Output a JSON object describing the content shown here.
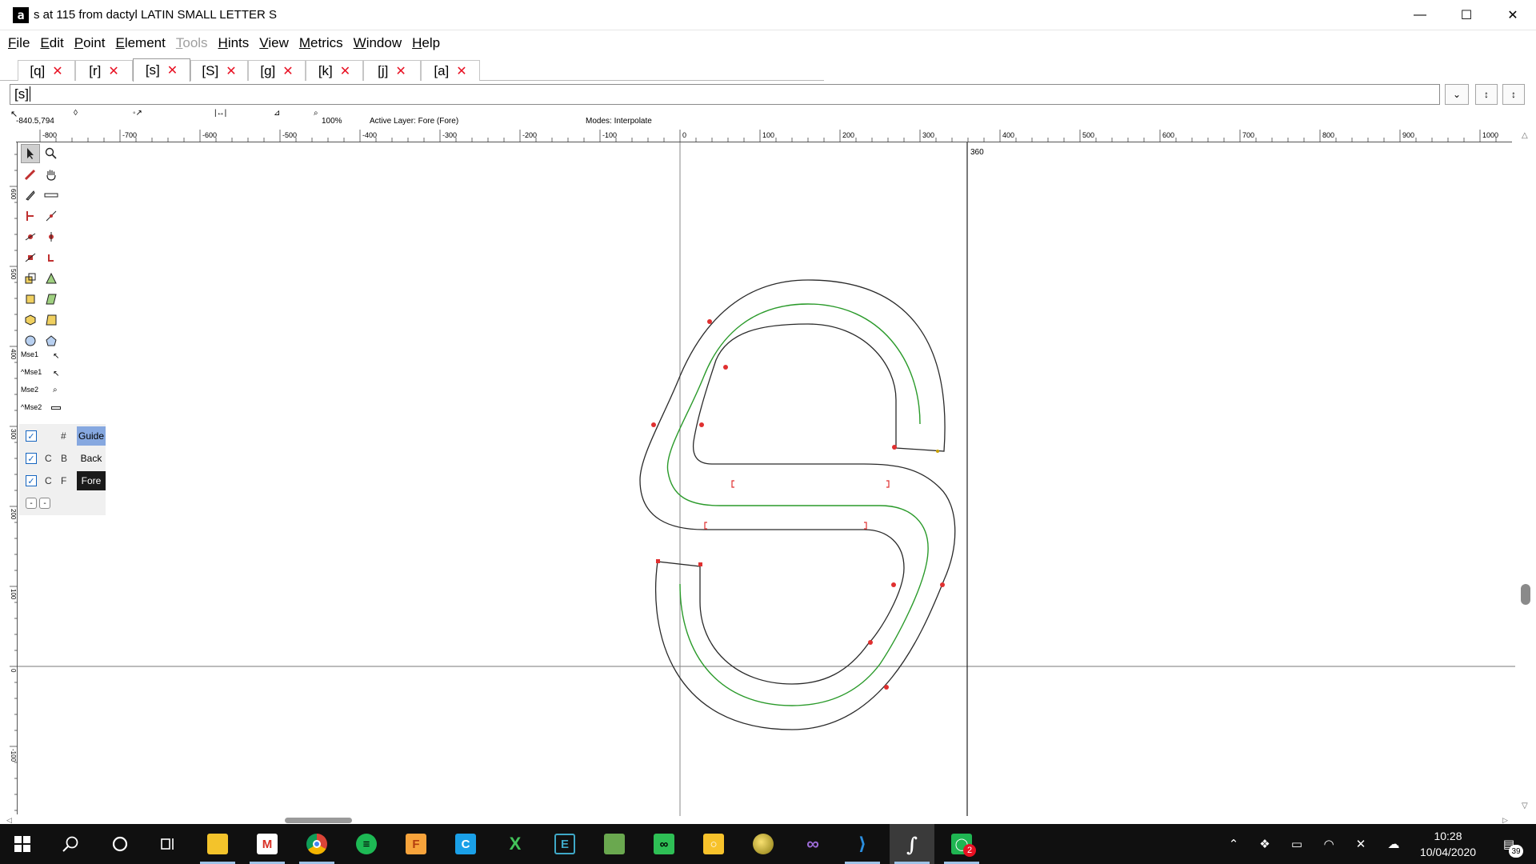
{
  "window": {
    "icon_letter": "a",
    "title": "s at 115 from dactyl LATIN SMALL LETTER S"
  },
  "menu": [
    {
      "label": "File",
      "key": "F",
      "rest": "ile"
    },
    {
      "label": "Edit",
      "key": "E",
      "rest": "dit"
    },
    {
      "label": "Point",
      "key": "P",
      "rest": "oint"
    },
    {
      "label": "Element",
      "key": "E",
      "rest": "lement"
    },
    {
      "label": "Tools",
      "key": "T",
      "rest": "ools"
    },
    {
      "label": "Hints",
      "key": "H",
      "rest": "ints"
    },
    {
      "label": "View",
      "key": "V",
      "rest": "iew"
    },
    {
      "label": "Metrics",
      "key": "M",
      "rest": "etrics"
    },
    {
      "label": "Window",
      "key": "W",
      "rest": "indow"
    },
    {
      "label": "Help",
      "key": "H",
      "rest": "elp"
    }
  ],
  "tabs": [
    "[q]",
    "[r]",
    "[s]",
    "[S]",
    "[g]",
    "[k]",
    "[j]",
    "[a]"
  ],
  "tab_close_glyph": "✕",
  "glyph_input": {
    "value": "[s]"
  },
  "info": {
    "coords": "-840.5,794",
    "zoom": "100%",
    "active_layer": "Active Layer: Fore (Fore)",
    "modes": "Modes: Interpolate"
  },
  "ruler": {
    "h_labels": [
      "-800",
      "-700",
      "-600",
      "-500",
      "-400",
      "-300",
      "-200",
      "-100",
      "0",
      "100",
      "200",
      "300",
      "400",
      "500",
      "600",
      "700",
      "800",
      "900",
      "1000"
    ],
    "v_labels": [
      "600",
      "500",
      "400",
      "300",
      "200",
      "100",
      "0",
      "-100"
    ]
  },
  "advance_width_label": "360",
  "toolbox": {
    "mouse_labels": [
      "Mse1",
      "^Mse1",
      "Mse2",
      "^Mse2"
    ]
  },
  "layers": [
    {
      "c": "",
      "key": "#",
      "name": "Guide"
    },
    {
      "c": "C",
      "key": "B",
      "name": "Back"
    },
    {
      "c": "C",
      "key": "F",
      "name": "Fore"
    }
  ],
  "layer_buttons": [
    "-",
    "-"
  ],
  "taskbar": {
    "time": "10:28",
    "date": "10/04/2020",
    "whatsapp_badge": "2",
    "notification_count": "39"
  },
  "colors": {
    "outline": "#2a2a2a",
    "spine": "#2a9a2a",
    "point": "#e03030",
    "layer_guide_bg": "#86a8e0",
    "layer_fore_bg": "#1a1a1a",
    "taskbar": "#101010"
  }
}
